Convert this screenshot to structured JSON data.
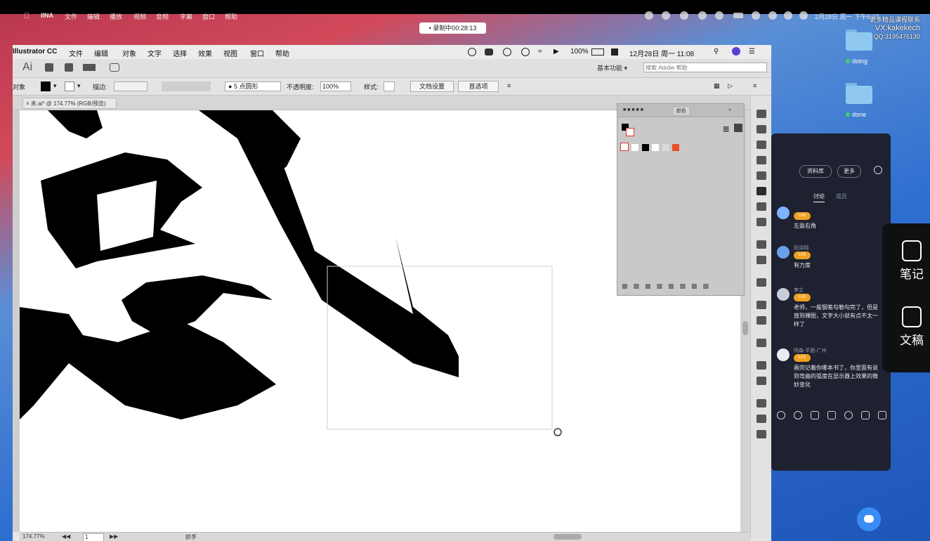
{
  "system_menubar": {
    "app": "IINA",
    "items": [
      "文件",
      "编辑",
      "播放",
      "视频",
      "音频",
      "字幕",
      "窗口",
      "帮助"
    ],
    "datetime": "2月28日 周一 下午6:37"
  },
  "recording_badge": "• 录制中00:28:13",
  "watermark": {
    "line1": "更多精品课程联系",
    "line2": "VX:kakekech",
    "line3": "QQ:3195476130"
  },
  "desktop_folders": [
    {
      "label": "doing",
      "color": "#44d16a"
    },
    {
      "label": "done",
      "color": "#44d16a"
    }
  ],
  "illustrator": {
    "menubar": {
      "app_name": "Illustrator CC",
      "items": [
        "文件",
        "编辑",
        "对象",
        "文字",
        "选择",
        "效果",
        "视图",
        "窗口",
        "帮助"
      ],
      "battery": "100%",
      "datetime": "12月28日 周一 11:08"
    },
    "topbar": {
      "logo": "Ai",
      "workspace": "基本功能",
      "search_placeholder": "搜索 Adobe 帮助"
    },
    "control_bar": {
      "selection_label": "对象",
      "stroke_label": "描边:",
      "brush": "5 点圆形",
      "opacity_label": "不透明度:",
      "opacity_value": "100%",
      "style_label": "样式:",
      "doc_setup_button": "文档设置",
      "preferences_button": "首选项"
    },
    "document_tab": "未.ai* @ 174.77% (RGB/预览)",
    "status_bar": {
      "zoom": "174.77%",
      "artboard": "1",
      "tool": "抓手"
    },
    "color_panel": {
      "tabs": [
        "颜色"
      ],
      "swatches": [
        "#ffffff",
        "#000000",
        "#ffffff",
        "#d9d9d9",
        "#e8512a"
      ]
    }
  },
  "chat_panel": {
    "buttons": [
      "资料库",
      "更多"
    ],
    "tabs": [
      "讨论",
      "成员"
    ],
    "active_tab": "讨论",
    "messages": [
      {
        "name": "",
        "level": "LV6",
        "text": "左盈右角"
      },
      {
        "name": "阳泽翔",
        "level": "LV6",
        "text": "有力度"
      },
      {
        "name": "李立",
        "level": "LV3",
        "text": "老师，一般钢笔勾勒勾完了，但是放到裸图，文字大小就有点不太一样了"
      },
      {
        "name": "阿森-平面-广州",
        "level": "LV1",
        "text": "画完记着你哪本书了，你里面有说到弯曲的弧度在显示器上效果的微妙变化"
      }
    ]
  },
  "side_tools": [
    {
      "label": "笔记",
      "icon": "note-edit-icon"
    },
    {
      "label": "文稿",
      "icon": "ai-document-icon"
    }
  ]
}
